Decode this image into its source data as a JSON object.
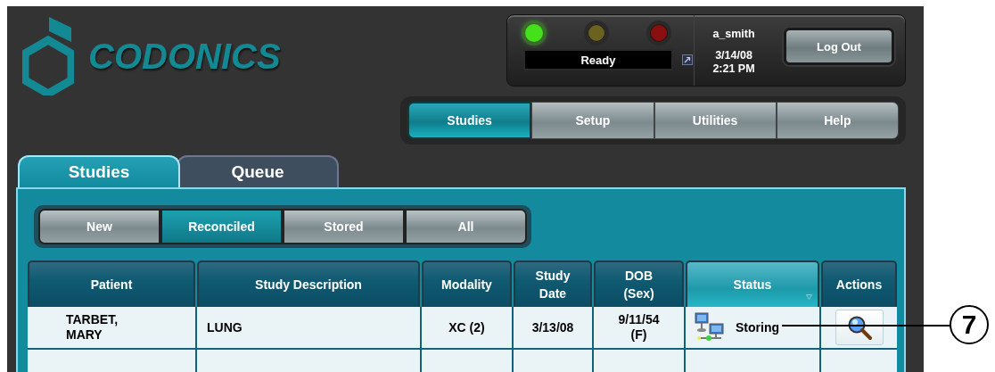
{
  "logo": "CODONICS",
  "status_panel": {
    "lights": [
      {
        "color": "#44e01c",
        "on": true
      },
      {
        "color": "#6b6220",
        "on": false
      },
      {
        "color": "#8a1010",
        "on": false
      }
    ],
    "status_text": "Ready",
    "user": "a_smith",
    "date": "3/14/08",
    "time": "2:21 PM",
    "logout": "Log Out"
  },
  "nav": [
    {
      "label": "Studies",
      "selected": true
    },
    {
      "label": "Setup",
      "selected": false
    },
    {
      "label": "Utilities",
      "selected": false
    },
    {
      "label": "Help",
      "selected": false
    }
  ],
  "tabs": [
    {
      "label": "Studies",
      "selected": true
    },
    {
      "label": "Queue",
      "selected": false
    }
  ],
  "filters": [
    {
      "label": "New",
      "selected": false
    },
    {
      "label": "Reconciled",
      "selected": true
    },
    {
      "label": "Stored",
      "selected": false
    },
    {
      "label": "All",
      "selected": false
    }
  ],
  "table": {
    "columns": [
      {
        "label": "Patient",
        "sorted": false
      },
      {
        "label": "Study Description",
        "sorted": false
      },
      {
        "label": "Modality",
        "sorted": false
      },
      {
        "label": "Study Date",
        "sorted": false
      },
      {
        "label": "DOB (Sex)",
        "sorted": false
      },
      {
        "label": "Status",
        "sorted": true
      },
      {
        "label": "Actions",
        "sorted": false
      }
    ],
    "rows": [
      {
        "patient": "TARBET, MARY",
        "description": "LUNG",
        "modality": "XC (2)",
        "study_date": "3/13/08",
        "dob": "9/11/54 (F)",
        "status": "Storing"
      }
    ]
  },
  "callout": {
    "label": "7"
  }
}
